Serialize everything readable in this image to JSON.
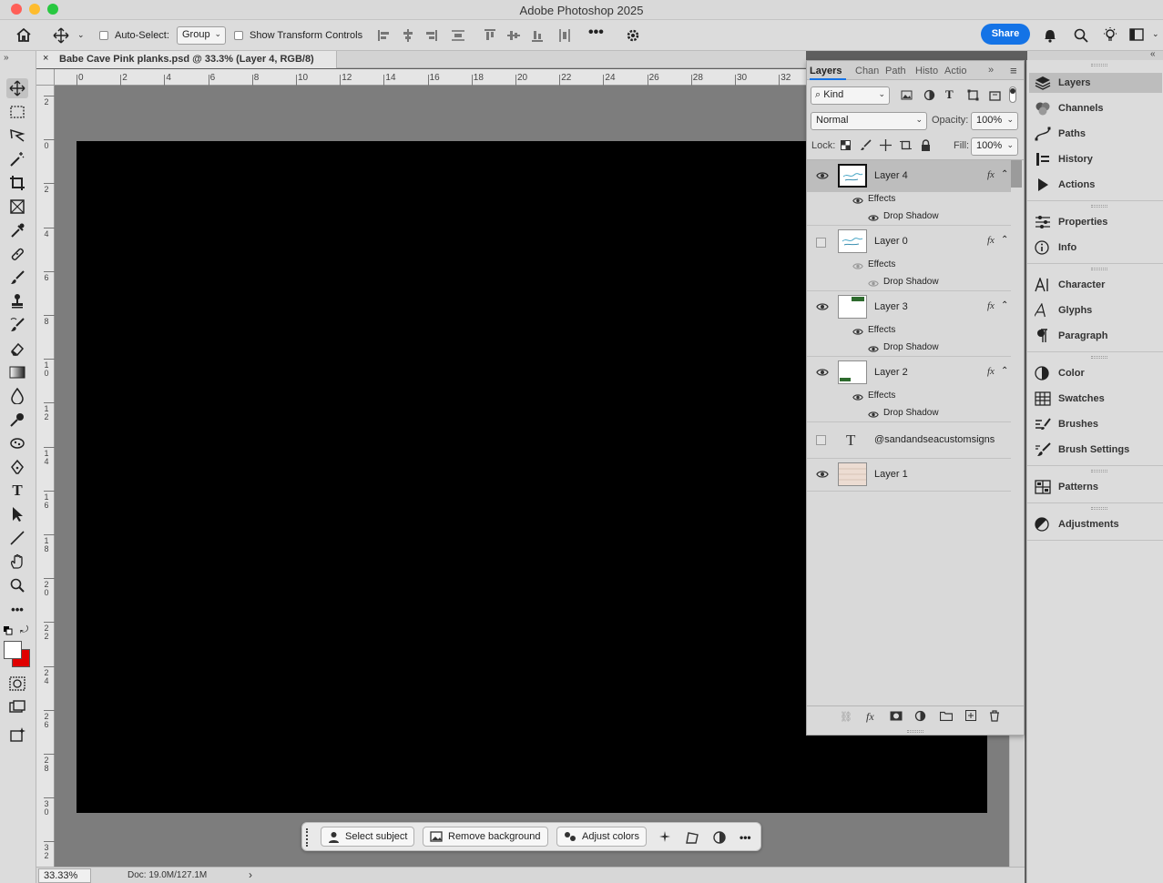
{
  "app": {
    "title": "Adobe Photoshop 2025"
  },
  "options": {
    "auto_select_label": "Auto-Select:",
    "auto_select_value": "Group",
    "show_transform_label": "Show Transform Controls",
    "share_label": "Share"
  },
  "document": {
    "tab_title": "Babe Cave Pink planks.psd @ 33.3% (Layer 4, RGB/8)",
    "close_glyph": "×"
  },
  "rulers": {
    "horizontal": [
      "0",
      "2",
      "4",
      "6",
      "8",
      "10",
      "12",
      "14",
      "16",
      "18",
      "20",
      "22",
      "24",
      "26",
      "28",
      "30",
      "32"
    ],
    "vertical": [
      "2",
      "0",
      "2",
      "4",
      "6",
      "8",
      "10",
      "12",
      "14",
      "16",
      "18",
      "20",
      "22",
      "24",
      "26",
      "28",
      "30",
      "32"
    ]
  },
  "context_bar": {
    "select_subject": "Select subject",
    "remove_background": "Remove background",
    "adjust_colors": "Adjust colors"
  },
  "status": {
    "zoom": "33.33%",
    "doc": "Doc: 19.0M/127.1M",
    "arrow": "›"
  },
  "layers_panel": {
    "tabs": [
      "Layers",
      "Chan",
      "Path",
      "Histo",
      "Actio"
    ],
    "filter_kind": "Kind",
    "blend_mode": "Normal",
    "opacity_label": "Opacity:",
    "opacity_value": "100%",
    "lock_label": "Lock:",
    "fill_label": "Fill:",
    "fill_value": "100%",
    "effects_label": "Effects",
    "drop_shadow_label": "Drop Shadow",
    "layers": [
      {
        "name": "Layer 4",
        "visible": true,
        "selected": true,
        "fx": true
      },
      {
        "name": "Layer 0",
        "visible": false,
        "selected": false,
        "fx": true
      },
      {
        "name": "Layer 3",
        "visible": true,
        "selected": false,
        "fx": true
      },
      {
        "name": "Layer 2",
        "visible": true,
        "selected": false,
        "fx": true
      },
      {
        "name": "@sandandseacustomsigns",
        "visible": false,
        "selected": false,
        "fx": false,
        "type": "text"
      },
      {
        "name": "Layer 1",
        "visible": true,
        "selected": false,
        "fx": false
      }
    ],
    "fx_glyph": "fx",
    "text_glyph": "T"
  },
  "right_panel": {
    "items": [
      "Layers",
      "Channels",
      "Paths",
      "History",
      "Actions",
      "Properties",
      "Info",
      "Character",
      "Glyphs",
      "Paragraph",
      "Color",
      "Swatches",
      "Brushes",
      "Brush Settings",
      "Patterns",
      "Adjustments"
    ]
  },
  "colors": {
    "accent": "#1473e6",
    "foreground": "#ffffff",
    "background": "#e00000",
    "canvas": "#000000"
  }
}
